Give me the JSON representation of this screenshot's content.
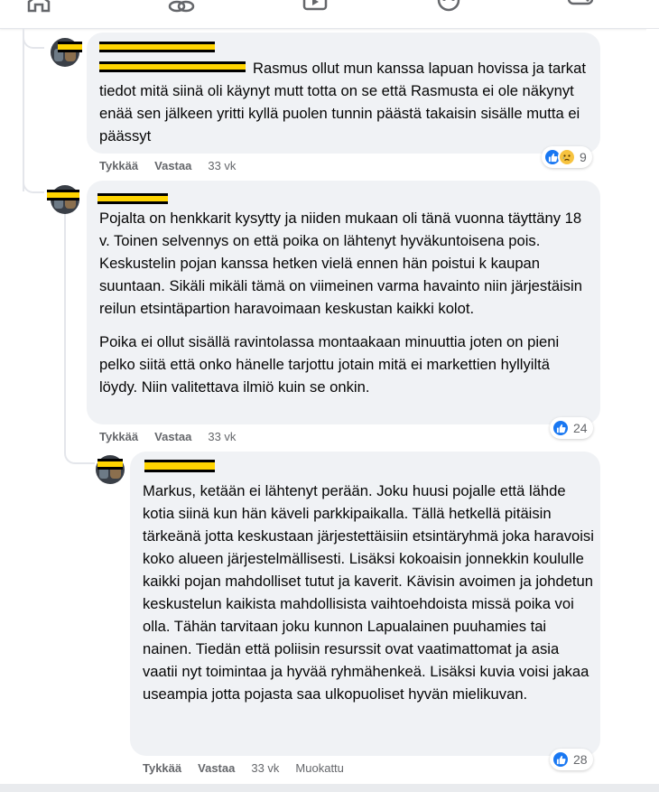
{
  "colors": {
    "like": "#1877f2",
    "sad": "#f7c33f",
    "bubble": "#f0f2f5",
    "meta": "#65676b",
    "redaction": "#ffd400"
  },
  "nav": [
    "home-icon",
    "groups-icon",
    "video-icon",
    "marketplace-icon",
    "gaming-icon"
  ],
  "comments": [
    {
      "text": "Rasmus ollut mun kanssa lapuan hovissa ja tarkat tiedot mitä siinä oli käynyt mutt totta on se että Rasmusta ei ole näkynyt enää sen jälkeen yritti kyllä puolen tunnin päästä takaisin sisälle mutta ei päässyt",
      "like": "Tykkää",
      "reply": "Vastaa",
      "time": "33 vk",
      "reactions": {
        "icons": [
          "like",
          "sad"
        ],
        "count": "9"
      }
    },
    {
      "paragraphs": [
        "Pojalta on henkkarit kysytty ja niiden mukaan oli tänä vuonna täyttäny 18 v. Toinen selvennys on että poika on lähtenyt hyväkuntoisena pois. Keskustelin pojan kanssa hetken vielä ennen hän poistui k kaupan suuntaan. Sikäli mikäli tämä on viimeinen varma havainto niin järjestäisin reilun etsintäpartion haravoimaan keskustan kaikki kolot.",
        "Poika ei ollut sisällä ravintolassa montaakaan minuuttia joten on pieni pelko siitä että onko hänelle tarjottu jotain mitä ei markettien hyllyiltä löydy. Niin valitettava ilmiö kuin se onkin."
      ],
      "like": "Tykkää",
      "reply": "Vastaa",
      "time": "33 vk",
      "reactions": {
        "icons": [
          "like"
        ],
        "count": "24"
      }
    },
    {
      "text": "Markus, ketään ei lähtenyt perään. Joku huusi pojalle että lähde kotia siinä kun hän käveli parkkipaikalla. Tällä hetkellä pitäisin tärkeänä jotta keskustaan järjestettäisiin etsintäryhmä joka haravoisi koko alueen järjestelmällisesti. Lisäksi kokoaisin jonnekkin koululle kaikki pojan mahdolliset tutut ja kaverit. Kävisin avoimen ja johdetun keskustelun kaikista mahdollisista vaihtoehdoista missä poika voi olla. Tähän tarvitaan joku kunnon Lapualainen puuhamies tai nainen. Tiedän että poliisin resurssit ovat vaatimattomat ja asia vaatii nyt toimintaa ja hyvää ryhmähenkeä. Lisäksi kuvia voisi jakaa useampia jotta pojasta saa ulkopuoliset hyvän mielikuvan.",
      "like": "Tykkää",
      "reply": "Vastaa",
      "time": "33 vk",
      "edited": "Muokattu",
      "reactions": {
        "icons": [
          "like"
        ],
        "count": "28"
      }
    }
  ]
}
